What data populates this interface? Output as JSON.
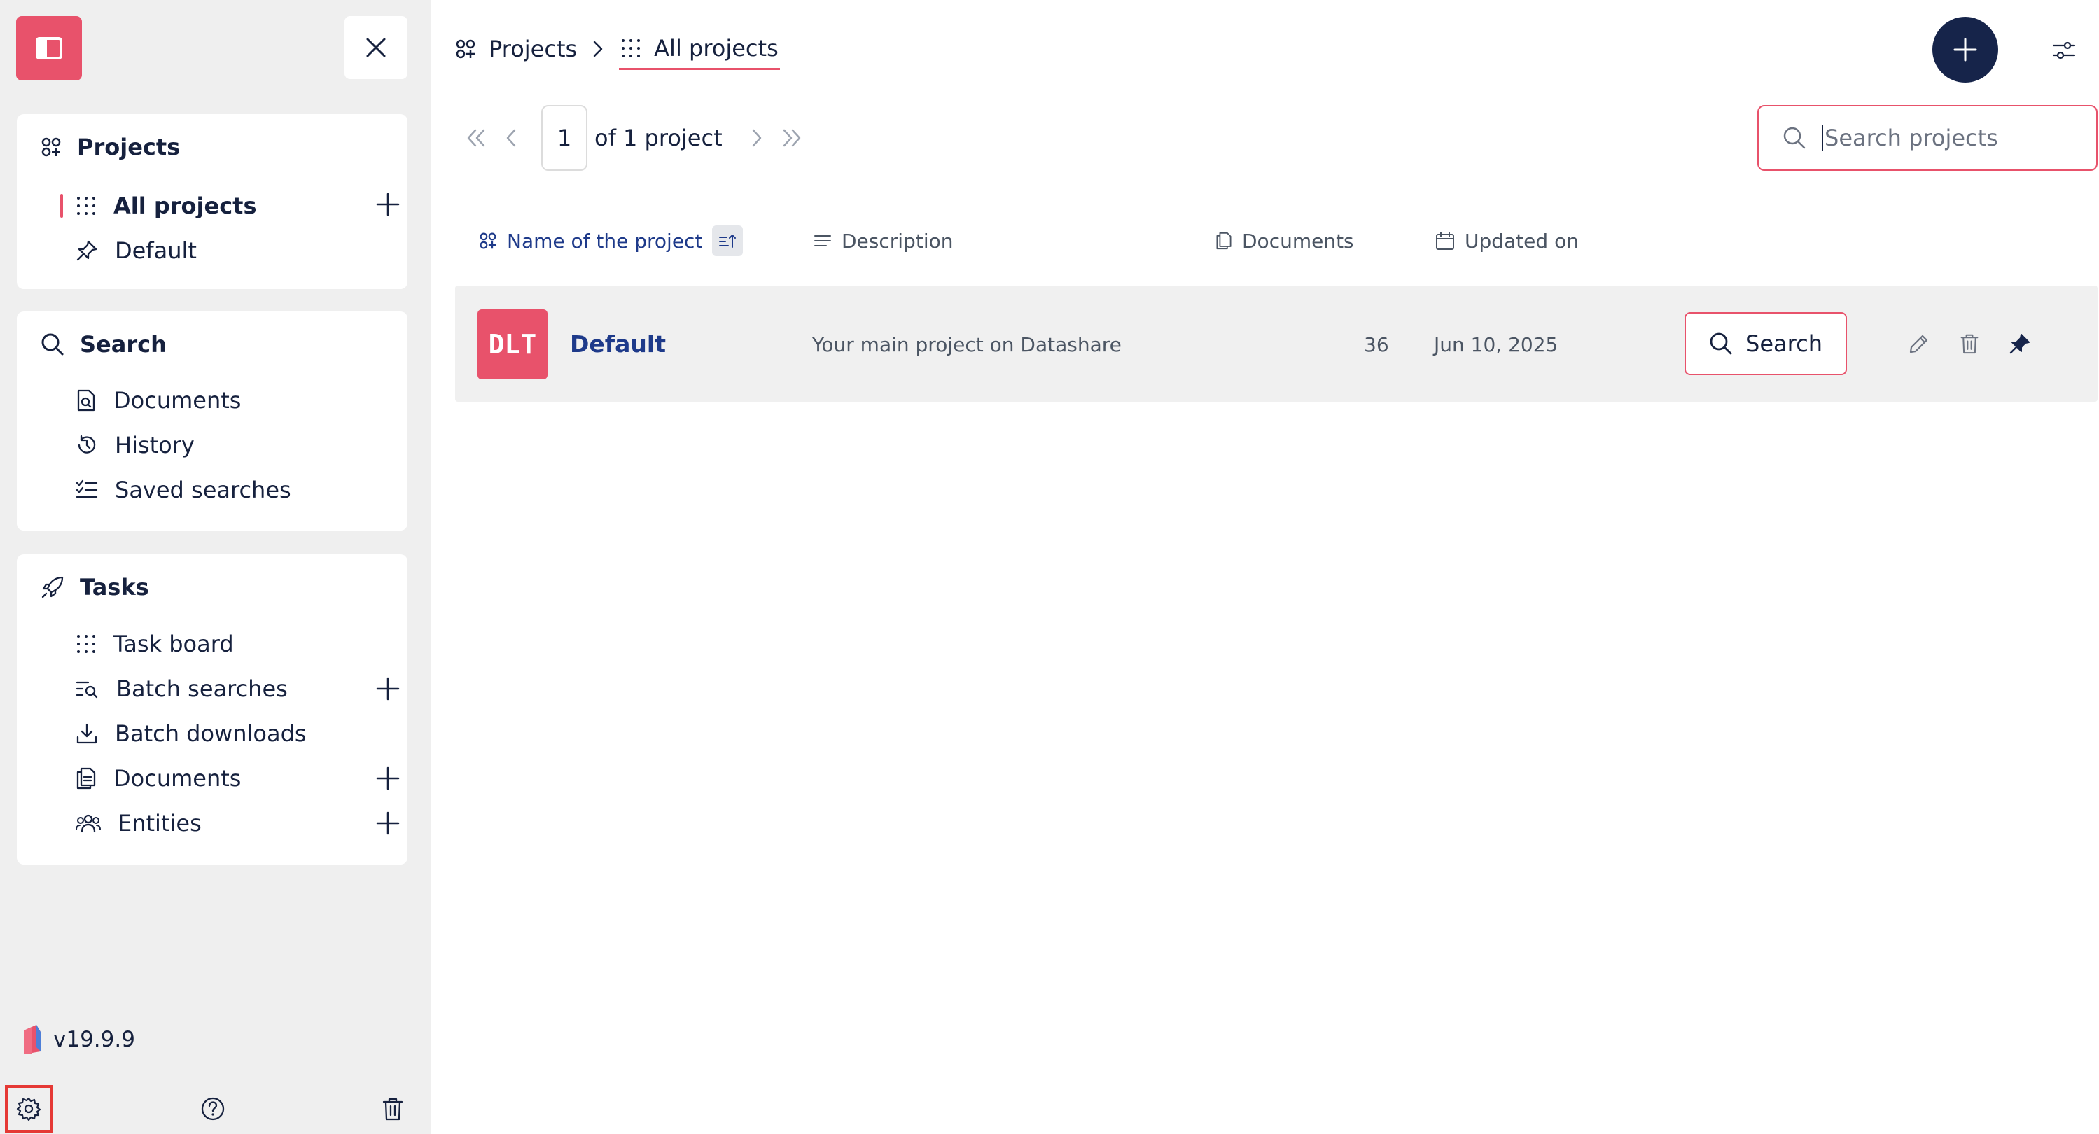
{
  "sidebar": {
    "toggle_icon": "sidebar-toggle-icon",
    "close_icon": "close-icon",
    "projects": {
      "title": "Projects",
      "items": [
        {
          "label": "All projects",
          "active": true,
          "has_add": true
        },
        {
          "label": "Default",
          "active": false,
          "has_add": false
        }
      ]
    },
    "search": {
      "title": "Search",
      "items": [
        {
          "label": "Documents"
        },
        {
          "label": "History"
        },
        {
          "label": "Saved searches"
        }
      ]
    },
    "tasks": {
      "title": "Tasks",
      "items": [
        {
          "label": "Task board",
          "has_add": false
        },
        {
          "label": "Batch searches",
          "has_add": true
        },
        {
          "label": "Batch downloads",
          "has_add": false
        },
        {
          "label": "Documents",
          "has_add": true
        },
        {
          "label": "Entities",
          "has_add": true
        }
      ]
    },
    "version": "v19.9.9"
  },
  "breadcrumb": {
    "root": "Projects",
    "current": "All projects"
  },
  "pagination": {
    "page": "1",
    "of_label": "of 1 project"
  },
  "search": {
    "placeholder": "Search projects"
  },
  "table": {
    "columns": [
      "Name of the project",
      "Description",
      "Documents",
      "Updated on"
    ],
    "rows": [
      {
        "avatar": "DLT",
        "name": "Default",
        "description": "Your main project on Datashare",
        "documents": "36",
        "updated": "Jun 10, 2025",
        "search_label": "Search"
      }
    ]
  },
  "colors": {
    "accent": "#e8526b",
    "primary_dark": "#16244a",
    "link": "#1e3a8a",
    "sidebar_bg": "#efefef"
  }
}
